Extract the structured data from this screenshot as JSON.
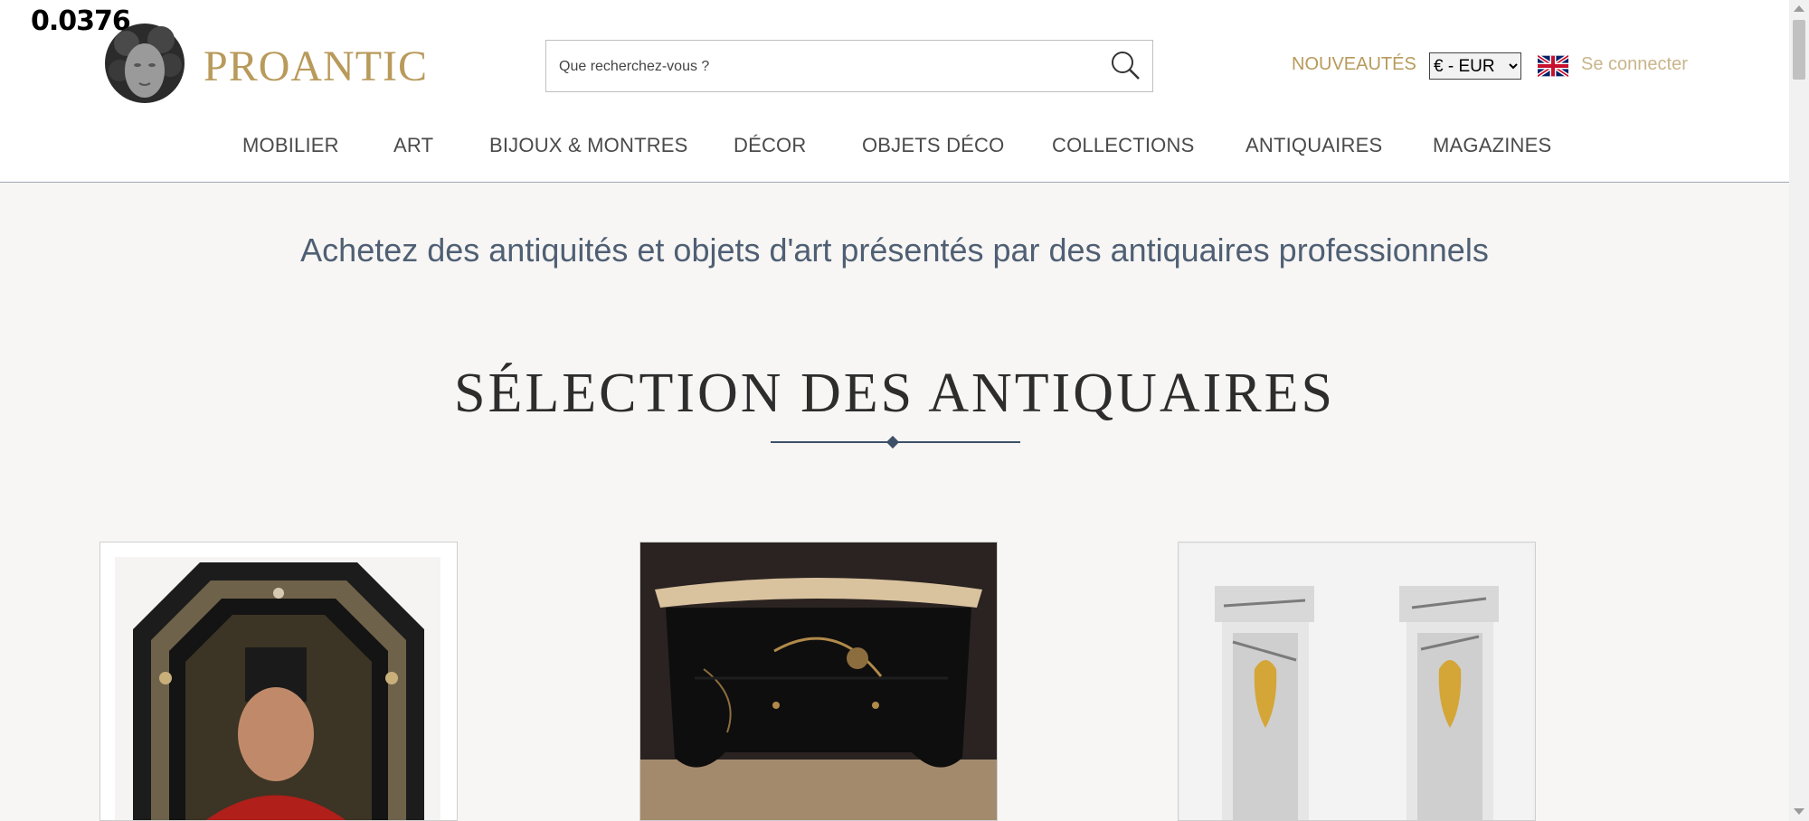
{
  "overlay": {
    "number": "0.0376"
  },
  "header": {
    "logo": "PROANTIC",
    "search_placeholder": "Que recherchez-vous ?",
    "nouveautes": "NOUVEAUTÉS",
    "currency": "€ - EUR",
    "login": "Se connecter"
  },
  "nav": {
    "items": [
      "MOBILIER",
      "ART",
      "BIJOUX & MONTRES",
      "DÉCOR",
      "OBJETS DÉCO",
      "COLLECTIONS",
      "ANTIQUAIRES",
      "MAGAZINES"
    ]
  },
  "main": {
    "tagline": "Achetez des antiquités et objets d'art présentés par des antiquaires professionnels",
    "section_title": "SÉLECTION DES ANTIQUAIRES"
  },
  "colors": {
    "brand_gold": "#b89a5b",
    "accent_blue": "#3e5068",
    "page_bg": "#f7f6f4"
  }
}
